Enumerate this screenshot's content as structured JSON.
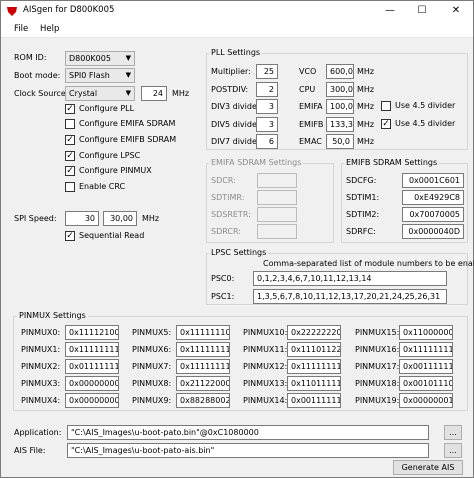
{
  "window": {
    "title": "AISgen for D800K005",
    "minimize": "—",
    "maximize": "☐",
    "close": "✕"
  },
  "menu": {
    "file": "File",
    "help": "Help"
  },
  "left": {
    "rom_id_label": "ROM ID:",
    "rom_id_value": "D800K005",
    "boot_mode_label": "Boot mode:",
    "boot_mode_value": "SPI0 Flash",
    "clock_source_label": "Clock Source:",
    "clock_source_value": "Crystal",
    "clock_mhz_value": "24",
    "clock_mhz_unit": "MHz",
    "checks": [
      {
        "label": "Configure PLL",
        "checked": true
      },
      {
        "label": "Configure EMIFA SDRAM",
        "checked": false
      },
      {
        "label": "Configure EMIFB SDRAM",
        "checked": true
      },
      {
        "label": "Configure LPSC",
        "checked": true
      },
      {
        "label": "Configure PINMUX",
        "checked": true
      },
      {
        "label": "Enable CRC",
        "checked": false
      }
    ],
    "spi_speed_label": "SPI Speed:",
    "spi_speed_value": "30",
    "spi_speed_actual": "30,00",
    "spi_speed_unit": "MHz",
    "sequential_read": {
      "label": "Sequential Read",
      "checked": true
    }
  },
  "pll": {
    "title": "PLL Settings",
    "multiplier_label": "Multiplier:",
    "multiplier_value": "25",
    "postdiv_label": "POSTDIV:",
    "postdiv_value": "2",
    "div3_label": "DIV3 divider:",
    "div3_value": "3",
    "div5_label": "DIV5 divider:",
    "div5_value": "3",
    "div7_label": "DIV7 divider:",
    "div7_value": "6",
    "vco_label": "VCO",
    "vco_value": "600,0",
    "vco_unit": "MHz",
    "cpu_label": "CPU",
    "cpu_value": "300,0",
    "cpu_unit": "MHz",
    "emifa_label": "EMIFA",
    "emifa_value": "100,0",
    "emifa_unit": "MHz",
    "emifb_label": "EMIFB",
    "emifb_value": "133,3",
    "emifb_unit": "MHz",
    "emac_label": "EMAC",
    "emac_value": "50,0",
    "emac_unit": "MHz",
    "emifa_div45": {
      "label": "Use 4.5 divider",
      "checked": false
    },
    "emifb_div45": {
      "label": "Use 4.5 divider",
      "checked": true
    }
  },
  "emifa": {
    "title": "EMIFA SDRAM Settings",
    "sdcr": "SDCR:",
    "sdtimr": "SDTIMR:",
    "sdsretr": "SDSRETR:",
    "sdrcr": "SDRCR:"
  },
  "emifb": {
    "title": "EMIFB SDRAM Settings",
    "sdcfg_label": "SDCFG:",
    "sdcfg_value": "0x0001C601",
    "sdtim1_label": "SDTIM1:",
    "sdtim1_value": "0xE4929C8",
    "sdtim2_label": "SDTIM2:",
    "sdtim2_value": "0x70070005",
    "sdrfc_label": "SDRFC:",
    "sdrfc_value": "0x0000040D"
  },
  "lpsc": {
    "title": "LPSC Settings",
    "hint": "Comma-separated list of module numbers to be enabled.",
    "psc0_label": "PSC0:",
    "psc0_value": "0,1,2,3,4,6,7,10,11,12,13,14",
    "psc1_label": "PSC1:",
    "psc1_value": "1,3,5,6,7,8,10,11,12,13,17,20,21,24,25,26,31"
  },
  "pinmux": {
    "title": "PINMUX Settings",
    "entries": [
      {
        "label": "PINMUX0:",
        "value": "0x11112100"
      },
      {
        "label": "PINMUX1:",
        "value": "0x11111111"
      },
      {
        "label": "PINMUX2:",
        "value": "0x01111111"
      },
      {
        "label": "PINMUX3:",
        "value": "0x00000000"
      },
      {
        "label": "PINMUX4:",
        "value": "0x00000000"
      },
      {
        "label": "PINMUX5:",
        "value": "0x11111110"
      },
      {
        "label": "PINMUX6:",
        "value": "0x11111111"
      },
      {
        "label": "PINMUX7:",
        "value": "0x11111111"
      },
      {
        "label": "PINMUX8:",
        "value": "0x21122000"
      },
      {
        "label": "PINMUX9:",
        "value": "0x88288002"
      },
      {
        "label": "PINMUX10:",
        "value": "0x22222220"
      },
      {
        "label": "PINMUX11:",
        "value": "0x11101122"
      },
      {
        "label": "PINMUX12:",
        "value": "0x11111111"
      },
      {
        "label": "PINMUX13:",
        "value": "0x11011111"
      },
      {
        "label": "PINMUX14:",
        "value": "0x00111111"
      },
      {
        "label": "PINMUX15:",
        "value": "0x11000000"
      },
      {
        "label": "PINMUX16:",
        "value": "0x11111111"
      },
      {
        "label": "PINMUX17:",
        "value": "0x00111111"
      },
      {
        "label": "PINMUX18:",
        "value": "0x00101110"
      },
      {
        "label": "PINMUX19:",
        "value": "0x00000001"
      }
    ]
  },
  "files": {
    "application_label": "Application:",
    "application_value": "\"C:\\AIS_Images\\u-boot-pato.bin\"@0xC1080000",
    "ais_file_label": "AIS File:",
    "ais_file_value": "\"C:\\AIS_Images\\u-boot-pato-ais.bin\"",
    "browse_label": "...",
    "generate_label": "Generate AIS"
  }
}
